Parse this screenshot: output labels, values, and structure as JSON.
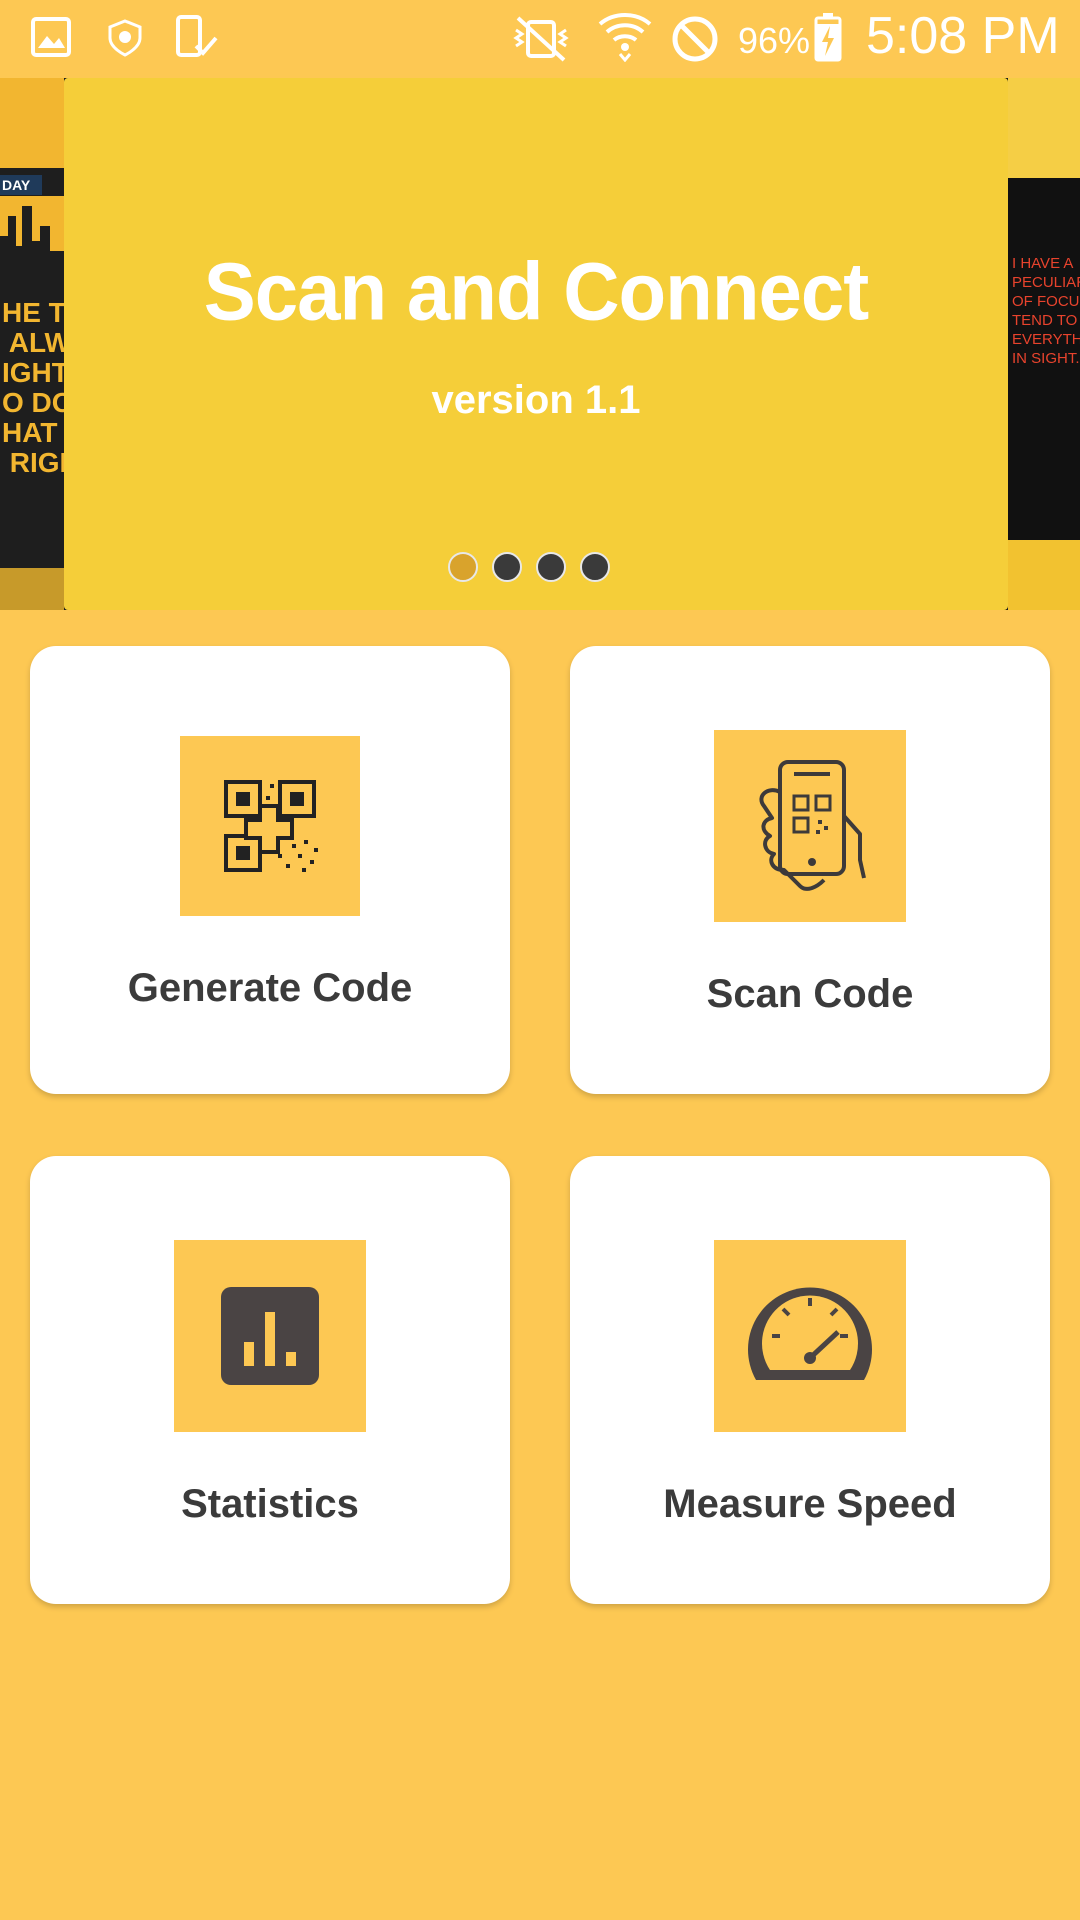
{
  "status_bar": {
    "battery": "96%",
    "time": "5:08 PM",
    "icons": [
      "image-notification-icon",
      "shield-icon",
      "device-check-icon",
      "vibrate-off-icon",
      "wifi-icon",
      "do-not-disturb-icon",
      "battery-charging-icon"
    ]
  },
  "banner": {
    "title": "Scan and Connect",
    "subtitle": "version 1.1",
    "left_peek": {
      "tag": "DAY",
      "quote": "HE TIM\n ALWAY\nIGHT\nO DO\nHAT\n RIGHT"
    },
    "right_peek": {
      "quote": "I HAVE A\nPECULIAR V\nOF FOCUS.\nTEND TO S\nEVERYTHIN\nIN SIGHT."
    },
    "active_slide": 1,
    "slide_count": 4
  },
  "menu": {
    "generate_label": "Generate Code",
    "scan_label": "Scan Code",
    "statistics_label": "Statistics",
    "speed_label": "Measure Speed"
  },
  "colors": {
    "background": "#FDC853",
    "slide": "#F5CE39",
    "card": "#FFFFFF",
    "text": "#3B3B3B",
    "icon": "#4A4444"
  }
}
